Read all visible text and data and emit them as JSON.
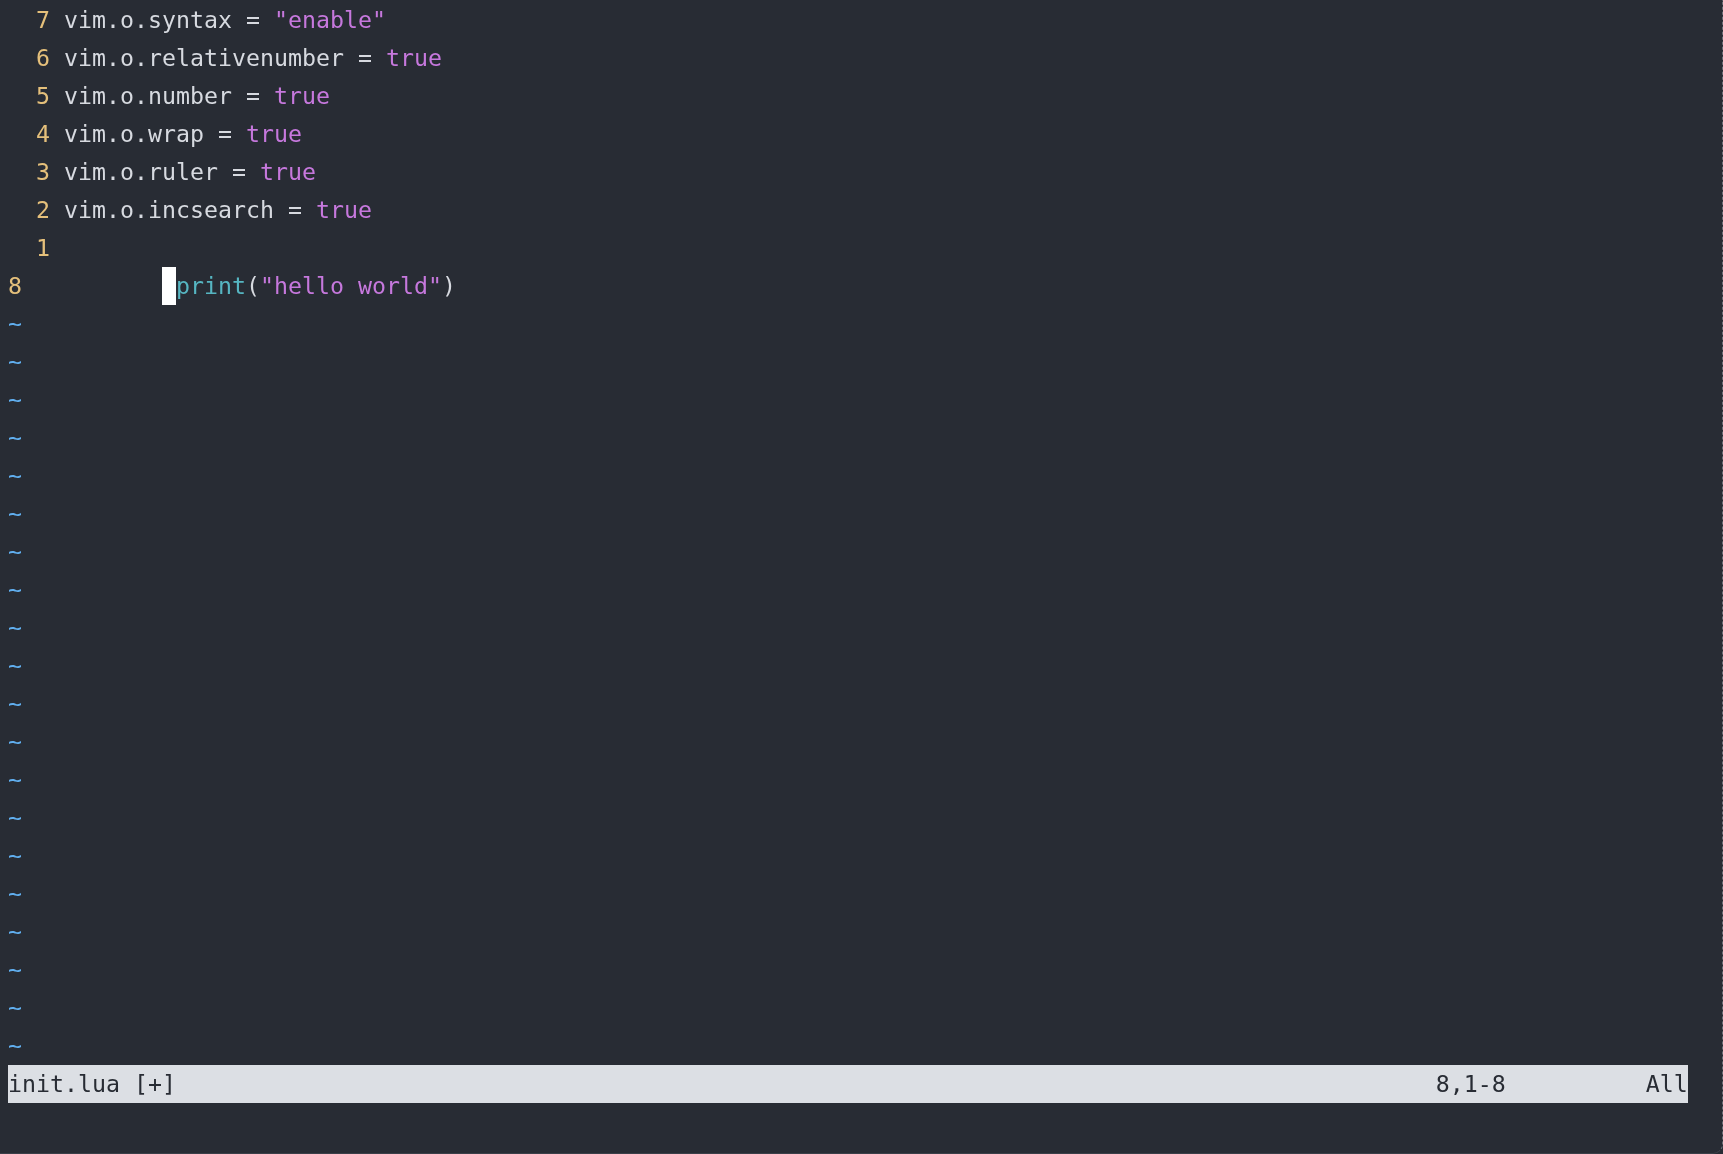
{
  "buffer": {
    "lines": [
      {
        "kind": "relative",
        "number": "7",
        "tokens": [
          {
            "kind": "plain",
            "text": "vim.o.syntax = "
          },
          {
            "kind": "string",
            "text": "\"enable\""
          }
        ]
      },
      {
        "kind": "relative",
        "number": "6",
        "tokens": [
          {
            "kind": "plain",
            "text": "vim.o.relativenumber = "
          },
          {
            "kind": "boolean",
            "text": "true"
          }
        ]
      },
      {
        "kind": "relative",
        "number": "5",
        "tokens": [
          {
            "kind": "plain",
            "text": "vim.o.number = "
          },
          {
            "kind": "boolean",
            "text": "true"
          }
        ]
      },
      {
        "kind": "relative",
        "number": "4",
        "tokens": [
          {
            "kind": "plain",
            "text": "vim.o.wrap = "
          },
          {
            "kind": "boolean",
            "text": "true"
          }
        ]
      },
      {
        "kind": "relative",
        "number": "3",
        "tokens": [
          {
            "kind": "plain",
            "text": "vim.o.ruler = "
          },
          {
            "kind": "boolean",
            "text": "true"
          }
        ]
      },
      {
        "kind": "relative",
        "number": "2",
        "tokens": [
          {
            "kind": "plain",
            "text": "vim.o.incsearch = "
          },
          {
            "kind": "boolean",
            "text": "true"
          }
        ]
      },
      {
        "kind": "relative",
        "number": "1"
      },
      {
        "kind": "cursor_line",
        "number": "8",
        "tokens": [
          {
            "kind": "tab",
            "cursor": true
          },
          {
            "kind": "function",
            "text": "print"
          },
          {
            "kind": "plain",
            "text": "("
          },
          {
            "kind": "string",
            "text": "\"hello world\""
          },
          {
            "kind": "plain",
            "text": ")"
          }
        ]
      }
    ],
    "filler": [
      "~",
      "~",
      "~",
      "~",
      "~",
      "~",
      "~",
      "~",
      "~",
      "~",
      "~",
      "~",
      "~",
      "~",
      "~",
      "~",
      "~",
      "~",
      "~",
      "~"
    ]
  },
  "status_line": {
    "file_name": "init.lua [+]",
    "position": "8,1-8",
    "scroll": "All"
  }
}
